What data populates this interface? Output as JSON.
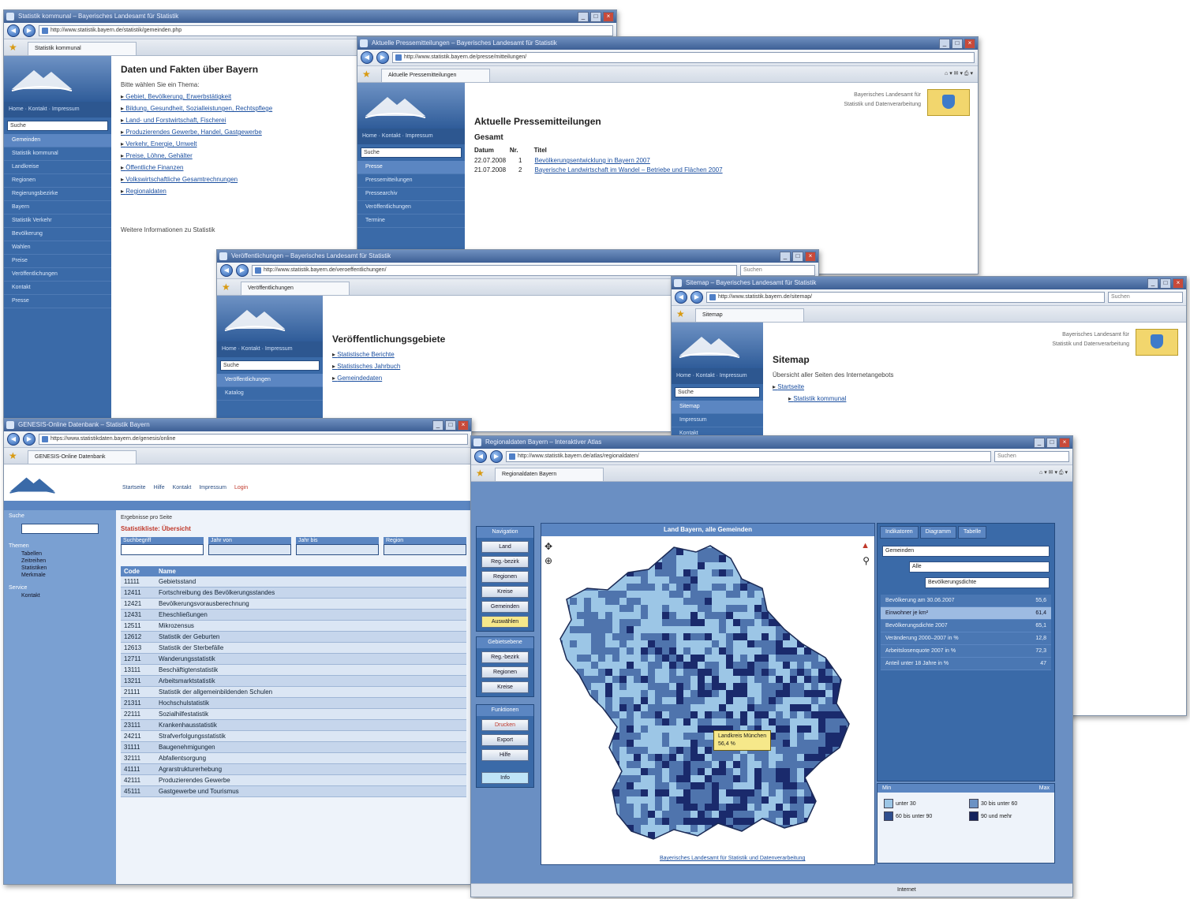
{
  "windows": {
    "w1": {
      "title": "Statistik kommunal – Bayerisches Landesamt für Statistik",
      "address": "http://www.statistik.bayern.de/statistik/gemeinden.php",
      "tab": "Statistik kommunal",
      "sidebar_select": "Suche",
      "nav_links": [
        "Home",
        "Kontakt",
        "Impressum"
      ],
      "sidebar_items": [
        "Gemeinden",
        "Statistik kommunal",
        "Landkreise",
        "Regionen",
        "Regierungsbezirke",
        "Bayern",
        "Statistik Verkehr",
        "Bevölkerung",
        "Wahlen",
        "Preise",
        "Veröffentlichungen",
        "Kontakt",
        "Presse"
      ],
      "heading": "Daten und Fakten über Bayern",
      "intro": "Bitte wählen Sie ein Thema:",
      "links": [
        "Gebiet, Bevölkerung, Erwerbstätigkeit",
        "Bildung, Gesundheit, Sozialleistungen, Rechtspflege",
        "Land- und Forstwirtschaft, Fischerei",
        "Produzierendes Gewerbe, Handel, Gastgewerbe",
        "Verkehr, Energie, Umwelt",
        "Preise, Löhne, Gehälter",
        "Öffentliche Finanzen",
        "Volkswirtschaftliche Gesamtrechnungen",
        "Regionaldaten"
      ],
      "footer": "Weitere Informationen zu Statistik"
    },
    "w2": {
      "title": "Aktuelle Pressemitteilungen – Bayerisches Landesamt für Statistik",
      "address": "http://www.statistik.bayern.de/presse/mitteilungen/",
      "tab": "Aktuelle Pressemitteilungen",
      "nav_links": [
        "Home",
        "Kontakt",
        "Impressum"
      ],
      "sidebar_select": "Suche",
      "sidebar_items": [
        "Presse",
        "Pressemitteilungen",
        "Pressearchiv",
        "Veröffentlichungen",
        "Termine"
      ],
      "header_text": [
        "Bayerisches Landesamt für",
        "Statistik und Datenverarbeitung"
      ],
      "heading": "Aktuelle Pressemitteilungen",
      "sub": "Gesamt",
      "cols": [
        "Datum",
        "Nr.",
        "Titel"
      ],
      "rows": [
        {
          "date": "22.07.2008",
          "nr": "1",
          "title": "Bevölkerungsentwicklung in Bayern 2007"
        },
        {
          "date": "21.07.2008",
          "nr": "2",
          "title": "Bayerische Landwirtschaft im Wandel – Betriebe und Flächen 2007"
        }
      ]
    },
    "w3": {
      "title": "Veröffentlichungen – Bayerisches Landesamt für Statistik",
      "address": "http://www.statistik.bayern.de/veroeffentlichungen/",
      "search": "Suchen",
      "tab": "Veröffentlichungen",
      "nav_links": [
        "Home",
        "Kontakt",
        "Impressum"
      ],
      "sidebar_select": "Suche",
      "sidebar_items": [
        "Veröffentlichungen",
        "Katalog"
      ],
      "heading": "Veröffentlichungsgebiete",
      "links": [
        "Statistische Berichte",
        "Statistisches Jahrbuch",
        "Gemeindedaten"
      ]
    },
    "w4": {
      "title": "Sitemap – Bayerisches Landesamt für Statistik",
      "address": "http://www.statistik.bayern.de/sitemap/",
      "search": "Suchen",
      "tab": "Sitemap",
      "nav_links": [
        "Home",
        "Kontakt",
        "Impressum"
      ],
      "sidebar_select": "Suche",
      "sidebar_items": [
        "Sitemap",
        "Impressum",
        "Kontakt"
      ],
      "header_text": [
        "Bayerisches Landesamt für",
        "Statistik und Datenverarbeitung"
      ],
      "heading": "Sitemap",
      "intro": "Übersicht aller Seiten des Internetangebots",
      "links": [
        "Startseite",
        "Statistik kommunal"
      ]
    },
    "w5": {
      "title": "GENESIS-Online Datenbank – Statistik Bayern",
      "address": "https://www.statistikdaten.bayern.de/genesis/online",
      "tab": "GENESIS-Online Datenbank",
      "topnav": [
        "Startseite",
        "Hilfe",
        "Kontakt",
        "Impressum",
        "Login"
      ],
      "side_label1": "Suche",
      "side_label2": "Themen",
      "side_items": [
        "Tabellen",
        "Zeitreihen",
        "Statistiken",
        "Merkmale"
      ],
      "side_label3": "Service",
      "side_item4": "Kontakt",
      "filter_label": "Ergebnisse pro Seite",
      "filter_title": "Statistikliste: Übersicht",
      "col_headers": [
        "Suchbegriff",
        "Jahr von",
        "Jahr bis",
        "Region"
      ],
      "table_headers": [
        "Code",
        "Name"
      ],
      "rows": [
        [
          "11111",
          "Gebietsstand"
        ],
        [
          "12411",
          "Fortschreibung des Bevölkerungsstandes"
        ],
        [
          "12421",
          "Bevölkerungsvorausberechnung"
        ],
        [
          "12431",
          "Eheschließungen"
        ],
        [
          "12511",
          "Mikrozensus"
        ],
        [
          "12612",
          "Statistik der Geburten"
        ],
        [
          "12613",
          "Statistik der Sterbefälle"
        ],
        [
          "12711",
          "Wanderungsstatistik"
        ],
        [
          "13111",
          "Beschäftigtenstatistik"
        ],
        [
          "13211",
          "Arbeitsmarktstatistik"
        ],
        [
          "21111",
          "Statistik der allgemeinbildenden Schulen"
        ],
        [
          "21311",
          "Hochschulstatistik"
        ],
        [
          "22111",
          "Sozialhilfestatistik"
        ],
        [
          "23111",
          "Krankenhausstatistik"
        ],
        [
          "24211",
          "Strafverfolgungsstatistik"
        ],
        [
          "31111",
          "Baugenehmigungen"
        ],
        [
          "32111",
          "Abfallentsorgung"
        ],
        [
          "41111",
          "Agrarstrukturerhebung"
        ],
        [
          "42111",
          "Produzierendes Gewerbe"
        ],
        [
          "45111",
          "Gastgewerbe und Tourismus"
        ]
      ]
    },
    "w6": {
      "title": "Regionaldaten Bayern – Interaktiver Atlas",
      "address": "http://www.statistik.bayern.de/atlas/regionaldaten/",
      "search": "Suchen",
      "tab": "Regionaldaten Bayern",
      "map_title": "Land Bayern, alle Gemeinden",
      "tool_head": "Navigation",
      "tools": [
        "Land",
        "Reg.-bezirk",
        "Regionen",
        "Kreise",
        "Gemeinden",
        "Auswählen"
      ],
      "tool_head2": "Gebietsebene",
      "tools2": [
        "Reg.-bezirk",
        "Regionen",
        "Kreise"
      ],
      "tool_head3": "Funktionen",
      "tools3": [
        "Drucken",
        "Export",
        "Hilfe"
      ],
      "tool_btn": "Info",
      "right_tabs": [
        "Indikatoren",
        "Diagramm",
        "Tabelle"
      ],
      "right_select": "Gemeinden",
      "right_select2": "Alle",
      "right_select3": "Bevölkerungsdichte",
      "indicators": [
        {
          "label": "Bevölkerung am 30.06.2007",
          "value": "55,6"
        },
        {
          "label": "Einwohner je km²",
          "value": "61,4"
        },
        {
          "label": "Bevölkerungsdichte 2007",
          "value": "65,1"
        },
        {
          "label": "Veränderung 2000–2007 in %",
          "value": "12,8"
        },
        {
          "label": "Arbeitslosenquote 2007 in %",
          "value": "72,3"
        },
        {
          "label": "Anteil unter 18 Jahre in %",
          "value": "47"
        }
      ],
      "highlight_index": 1,
      "slider_left": "Min",
      "slider_right": "Max",
      "legend": [
        {
          "label": "unter 30",
          "color": "#9cc6e6"
        },
        {
          "label": "30 bis unter 60",
          "color": "#6b92c4"
        },
        {
          "label": "60 bis unter 90",
          "color": "#2f4f8f"
        },
        {
          "label": "90 und mehr",
          "color": "#14245e"
        }
      ],
      "tooltip": [
        "Landkreis München",
        "56,4 %"
      ],
      "map_colors": {
        "low": "#9cc6e6",
        "mid": "#4f74ad",
        "high": "#1a2a6c"
      },
      "footer_link": "Bayerisches Landesamt für Statistik und Datenverarbeitung",
      "status": "Internet"
    }
  }
}
